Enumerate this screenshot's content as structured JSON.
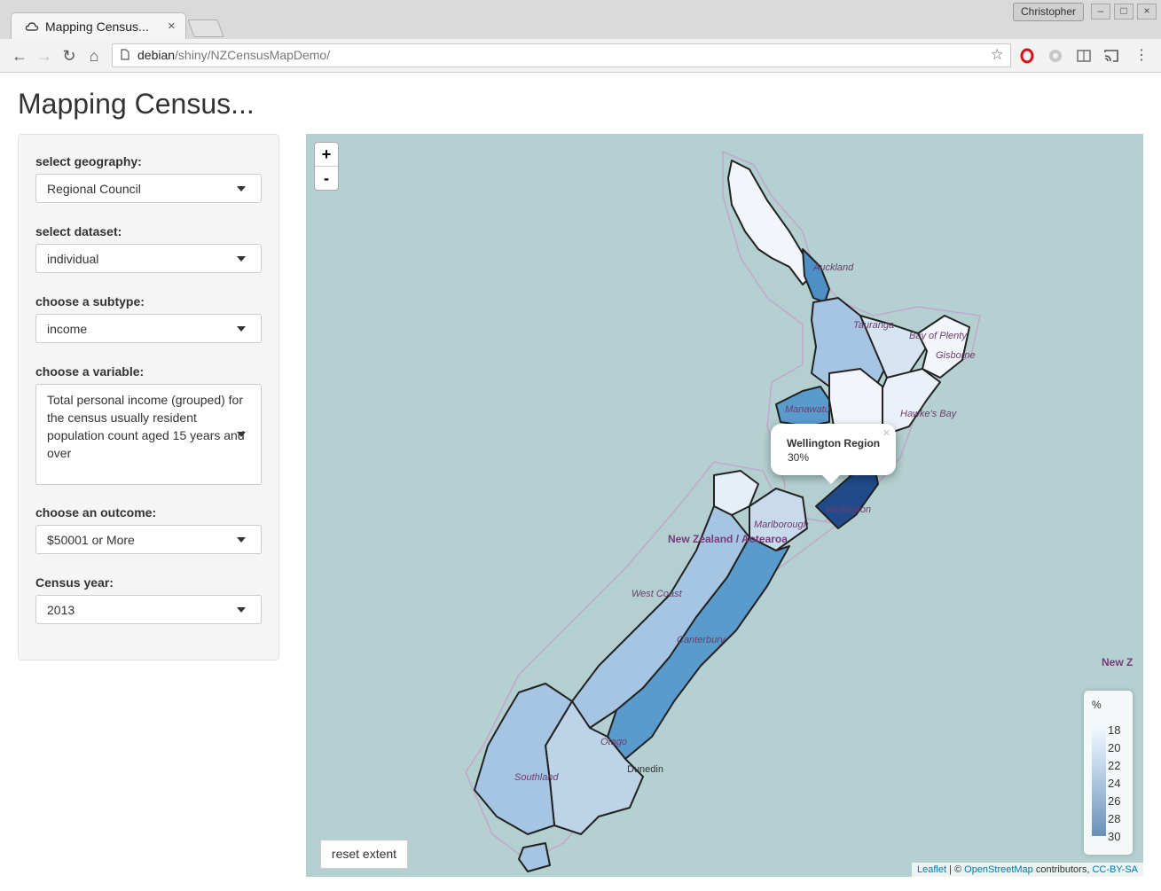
{
  "browser": {
    "tab_title": "Mapping Census...",
    "tab_close": "×",
    "profile_name": "Christopher",
    "url_host": "debian",
    "url_path": "/shiny/NZCensusMapDemo/"
  },
  "page": {
    "title": "Mapping Census..."
  },
  "controls": {
    "geography": {
      "label": "select geography:",
      "value": "Regional Council"
    },
    "dataset": {
      "label": "select dataset:",
      "value": "individual"
    },
    "subtype": {
      "label": "choose a subtype:",
      "value": "income"
    },
    "variable": {
      "label": "choose a variable:",
      "value": "Total personal income (grouped) for the census usually resident population count aged 15 years and over"
    },
    "outcome": {
      "label": "choose an outcome:",
      "value": "$50001 or More"
    },
    "year": {
      "label": "Census year:",
      "value": "2013"
    }
  },
  "map": {
    "zoom_in": "+",
    "zoom_out": "-",
    "popup": {
      "region": "Wellington Region",
      "value": "30%",
      "close": "×"
    },
    "legend": {
      "title": "%",
      "ticks": [
        "18",
        "20",
        "22",
        "24",
        "26",
        "28",
        "30"
      ]
    },
    "reset_button": "reset extent",
    "attribution": {
      "leaflet": "Leaflet",
      "sep": " | © ",
      "osm": "OpenStreetMap",
      "contributors": " contributors, ",
      "license": "CC-BY-SA"
    },
    "labels": {
      "auckland": "Auckland",
      "tauranga": "Tauranga",
      "bay_of_plenty": "Bay of Plenty",
      "gisborne": "Gisborne",
      "hawkes_bay": "Hawke's Bay",
      "manawatu": "Manawatu",
      "wellington": "Wellington",
      "marlborough": "Marlborough",
      "new_zealand": "New Zealand / Aotearoa",
      "west_coast": "West Coast",
      "canterbury": "Canterbury",
      "otago": "Otago",
      "southland": "Southland",
      "dunedin": "Dunedin",
      "new_z": "New Z"
    },
    "colors": {
      "water": "#b5d0d0",
      "lightest": "#f2f6fb",
      "light": "#c8daeb",
      "medium": "#a6c5e2",
      "dark": "#5a9bcd",
      "darkest": "#1f4b8a"
    }
  }
}
